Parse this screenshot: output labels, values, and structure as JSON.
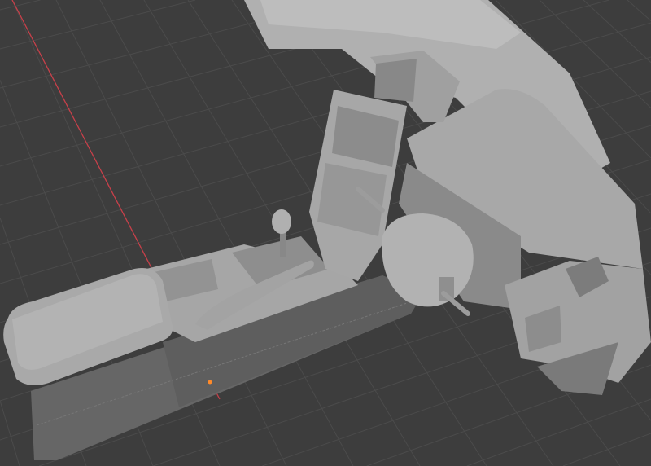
{
  "viewport": {
    "type": "3d-viewport",
    "shading": "solid",
    "colors": {
      "background": "#3d3d3d",
      "grid": "#4b4b4b",
      "x_axis": "#c8404a",
      "origin": "#ff8a2a",
      "model_light": "#b9b9b9",
      "model_mid": "#9a9a9a",
      "model_dark": "#6a6a6a"
    }
  },
  "scene": {
    "objects": [
      "center-console",
      "armrest",
      "gear-shifter",
      "handbrake",
      "dashboard",
      "instrument-cluster-hood",
      "steering-wheel-hub",
      "center-stack",
      "air-vent"
    ]
  }
}
